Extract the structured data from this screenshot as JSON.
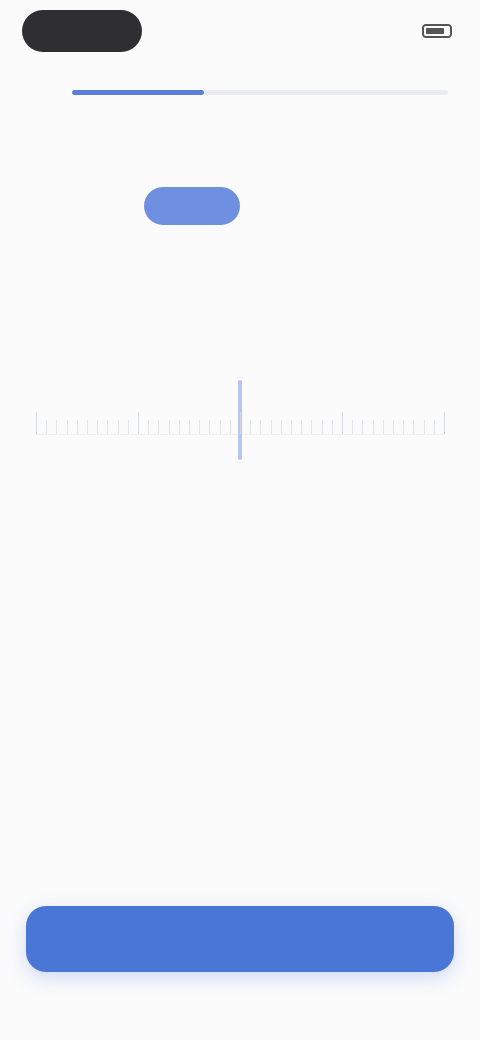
{
  "status_bar": {
    "time": "",
    "carrier": ""
  },
  "onboarding": {
    "progress_percent": 35,
    "title": "",
    "units": [
      {
        "label": "",
        "active": true
      },
      {
        "label": "",
        "active": false
      }
    ],
    "value": "",
    "unit_suffix": "",
    "ruler_labels": [
      "",
      "",
      "",
      ""
    ],
    "info_heading": "",
    "info_body": ""
  },
  "footer": {
    "cta_label": ""
  },
  "colors": {
    "accent": "#4a76d6",
    "progress": "#5b7fd8",
    "toggle_active": "#6f8fe0"
  }
}
